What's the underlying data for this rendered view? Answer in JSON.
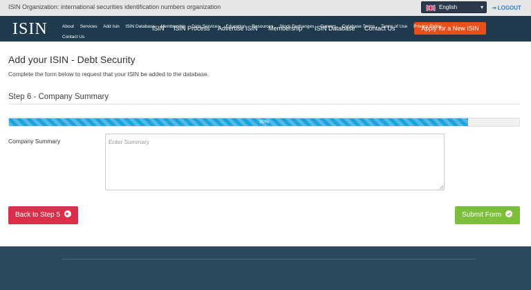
{
  "topbar": {
    "org_text": "ISIN Organization: international securities identification numbers organization",
    "language": "English",
    "logout": "LOGOUT"
  },
  "nav": {
    "logo": "ISIN",
    "items": [
      "ISIN",
      "ISIN Process",
      "Advertise ISIN",
      "Membership",
      "ISIN Database",
      "Contact Us"
    ],
    "apply_button": "Apply for a New ISIN"
  },
  "main": {
    "title": "Add your ISIN - Debt Security",
    "description": "Complete the form below to request that your ISIN be added to the database.",
    "step_title": "Step 6 - Company Summary",
    "progress": {
      "percent": 90,
      "label": "90%"
    },
    "company_summary": {
      "label": "Company Summary",
      "placeholder": "Enter Summary",
      "value": ""
    },
    "back_button": "Back to Step 5",
    "submit_button": "Submit Form"
  },
  "footer": {
    "links": [
      "About",
      "Services",
      "Add Isin",
      "ISIN Database",
      "Membership",
      "Data Services",
      "Education",
      "Resources",
      "Stock Exchanges",
      "Careers",
      "Database Terms",
      "Terms of Use",
      "Privacy Policy",
      "Contact Us"
    ]
  },
  "colors": {
    "nav_bg": "#1f3a4d",
    "apply_orange": "#e8501a",
    "progress_blue": "#1aa3dd",
    "back_red": "#db2e4a",
    "submit_green": "#7cbf3a",
    "footer_bg": "#2b4a5e"
  }
}
